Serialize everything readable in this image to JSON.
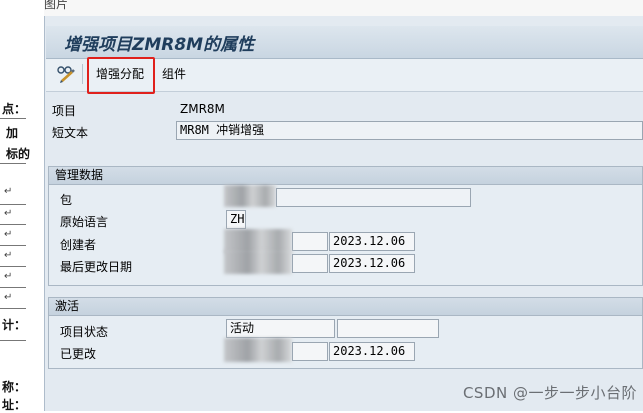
{
  "window": {
    "top_label": "图片",
    "title": "增强项目ZMR8M的属性"
  },
  "toolbar": {
    "display_change_icon": "glasses-pencil-icon",
    "enhancement_assignment_label": "增强分配",
    "components_label": "组件"
  },
  "header": {
    "project_label": "项目",
    "project_value": "ZMR8M",
    "short_text_label": "短文本",
    "short_text_value": "MR8M 冲销增强"
  },
  "mgmt": {
    "title": "管理数据",
    "package_label": "包",
    "orig_lang_label": "原始语言",
    "orig_lang_value": "ZH",
    "created_by_label": "创建者",
    "created_date": "2023.12.06",
    "last_changed_label": "最后更改日期",
    "last_changed_date": "2023.12.06"
  },
  "activation": {
    "title": "激活",
    "status_label": "项目状态",
    "status_value": "活动",
    "changed_label": "已更改",
    "changed_date": "2023.12.06"
  },
  "background_doc": {
    "lines": [
      "点：",
      "加",
      "标的",
      "计：",
      "称：",
      "址："
    ]
  },
  "watermark": "CSDN @一步一步小台阶"
}
